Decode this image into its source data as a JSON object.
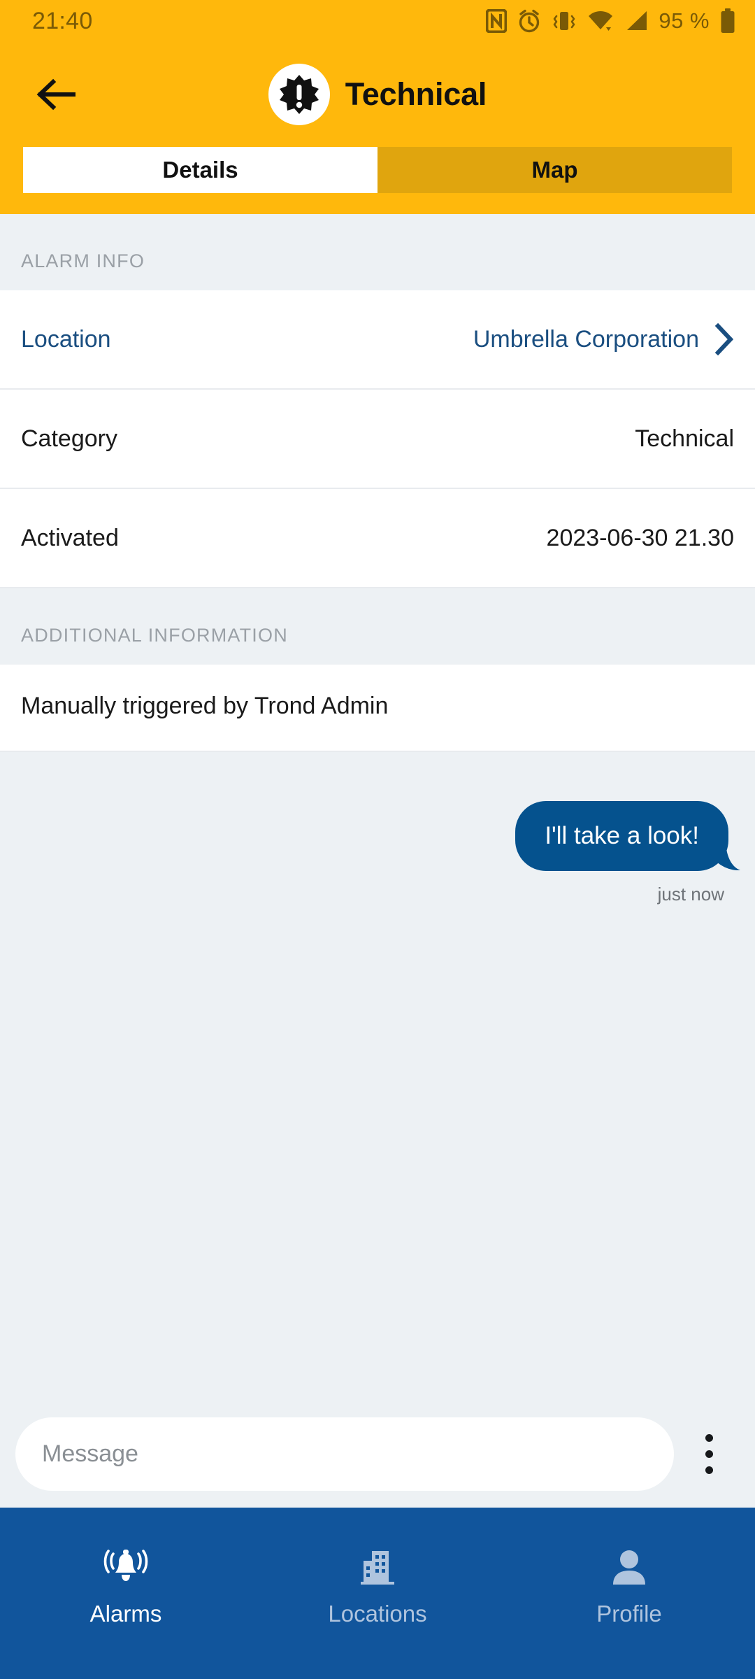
{
  "statusbar": {
    "time": "21:40",
    "battery_percent": "95 %",
    "icons": [
      "nfc-icon",
      "alarm-clock-icon",
      "vibrate-icon",
      "wifi-icon",
      "cellular-signal-icon",
      "battery-icon"
    ]
  },
  "appbar": {
    "back_icon": "back-arrow-icon",
    "badge_icon": "gear-alert-icon",
    "title": "Technical"
  },
  "tabs": [
    {
      "label": "Details",
      "active": true
    },
    {
      "label": "Map",
      "active": false
    }
  ],
  "sections": [
    {
      "header": "ALARM INFO",
      "rows": [
        {
          "label": "Location",
          "value": "Umbrella Corporation",
          "link": true,
          "chevron": true
        },
        {
          "label": "Category",
          "value": "Technical",
          "link": false,
          "chevron": false
        },
        {
          "label": "Activated",
          "value": "2023-06-30 21.30",
          "link": false,
          "chevron": false
        }
      ]
    },
    {
      "header": "ADDITIONAL INFORMATION",
      "text": "Manually triggered by Trond Admin"
    }
  ],
  "chat": {
    "messages": [
      {
        "text": "I'll take a look!",
        "time": "just now",
        "outgoing": true
      }
    ]
  },
  "composer": {
    "placeholder": "Message",
    "value": "",
    "menu_icon": "kebab-menu-icon"
  },
  "bottomnav": [
    {
      "label": "Alarms",
      "icon": "alarm-bell-icon",
      "active": true
    },
    {
      "label": "Locations",
      "icon": "building-icon",
      "active": false
    },
    {
      "label": "Profile",
      "icon": "person-icon",
      "active": false
    }
  ],
  "colors": {
    "brand_amber": "#FFB80C",
    "tab_inactive_amber": "#E0A50E",
    "accent_blue": "#1A4E80",
    "bubble_blue": "#05528E",
    "nav_blue": "#11559C",
    "page_bg": "#EDF1F4"
  }
}
